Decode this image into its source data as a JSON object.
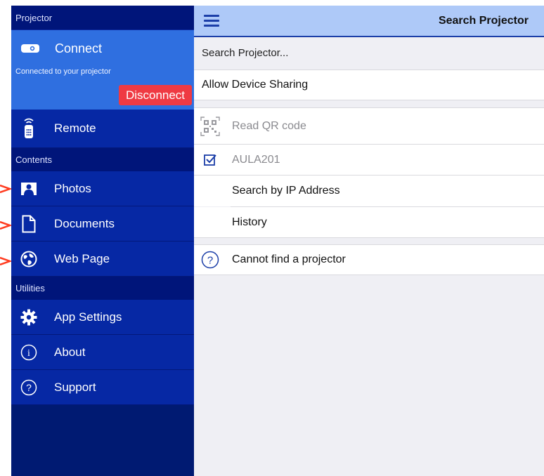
{
  "sidebar": {
    "header": "Projector",
    "connect": {
      "label": "Connect",
      "status": "Connected to your projector",
      "disconnect_label": "Disconnect"
    },
    "remote_label": "Remote",
    "contents_section": "Contents",
    "contents_items": [
      {
        "label": "Photos",
        "icon": "photo-icon"
      },
      {
        "label": "Documents",
        "icon": "document-icon"
      },
      {
        "label": "Web Page",
        "icon": "globe-icon"
      }
    ],
    "utilities_section": "Utilities",
    "utilities_items": [
      {
        "label": "App Settings",
        "icon": "gear-icon"
      },
      {
        "label": "About",
        "icon": "info-icon"
      },
      {
        "label": "Support",
        "icon": "help-icon"
      }
    ]
  },
  "topbar": {
    "title": "Search Projector",
    "menu_icon": "hamburger-icon"
  },
  "main": {
    "search_label": "Search Projector...",
    "allow_sharing": "Allow Device Sharing",
    "read_qr": "Read QR code",
    "projector_name": "AULA201",
    "search_ip": "Search by IP Address",
    "history": "History",
    "cannot_find": "Cannot find a projector"
  },
  "colors": {
    "sidebar_bg": "#0628a4",
    "connect_bg": "#2f6fe0",
    "disconnect_bg": "#ef3a43",
    "topbar_bg": "#aec9f8",
    "accent_blue": "#1b3ea8",
    "annotation_arrow": "#ff3b1f"
  }
}
